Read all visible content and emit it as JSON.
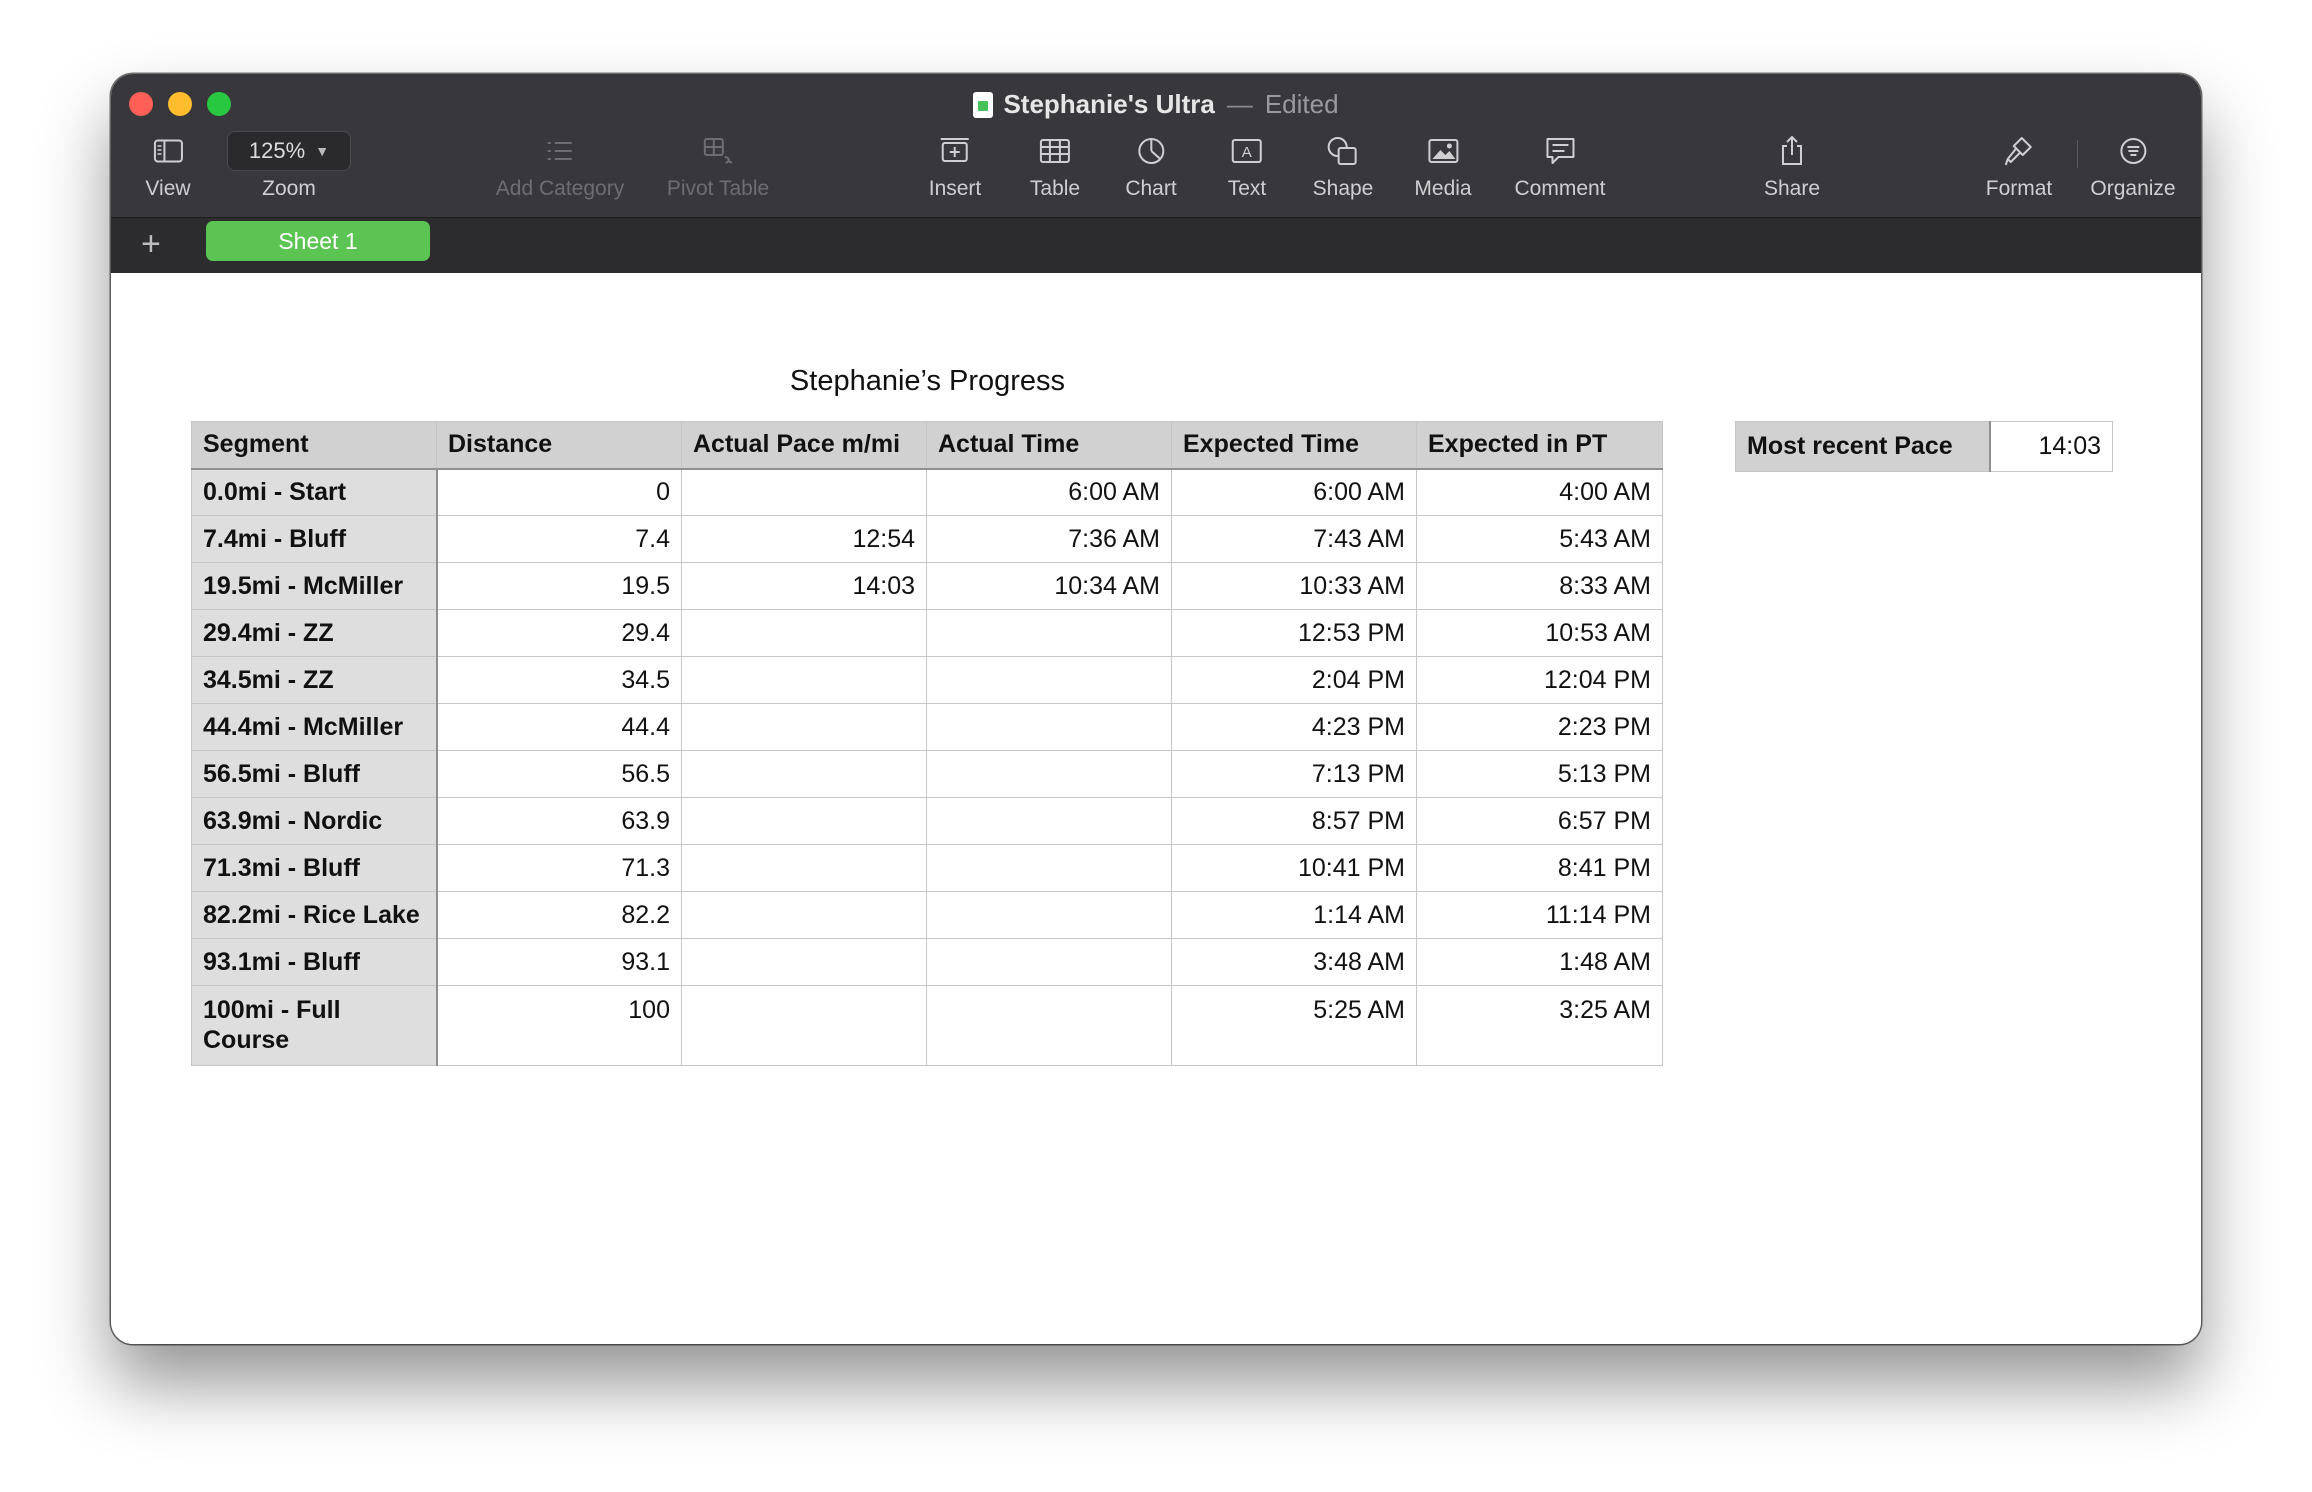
{
  "window": {
    "title": "Stephanie's Ultra",
    "separator": "—",
    "status": "Edited"
  },
  "toolbar": {
    "view": {
      "label": "View",
      "icon": "sidebar-icon"
    },
    "zoom": {
      "label": "Zoom",
      "value": "125%"
    },
    "add_category": {
      "label": "Add Category",
      "icon": "list-icon",
      "enabled": false
    },
    "pivot_table": {
      "label": "Pivot Table",
      "icon": "pivot-table-icon",
      "enabled": false
    },
    "insert": {
      "label": "Insert",
      "icon": "insert-icon"
    },
    "table": {
      "label": "Table",
      "icon": "table-icon"
    },
    "chart": {
      "label": "Chart",
      "icon": "chart-icon"
    },
    "text": {
      "label": "Text",
      "icon": "text-box-icon"
    },
    "shape": {
      "label": "Shape",
      "icon": "shape-icon"
    },
    "media": {
      "label": "Media",
      "icon": "media-icon"
    },
    "comment": {
      "label": "Comment",
      "icon": "comment-icon"
    },
    "share": {
      "label": "Share",
      "icon": "share-icon"
    },
    "format": {
      "label": "Format",
      "icon": "paintbrush-icon"
    },
    "organize": {
      "label": "Organize",
      "icon": "organize-icon"
    }
  },
  "sheets": {
    "add_label": "+",
    "tabs": [
      {
        "label": "Sheet 1",
        "active": true
      }
    ],
    "active_color": "#5cc452"
  },
  "progress_table": {
    "title": "Stephanie’s Progress",
    "columns": [
      "Segment",
      "Distance",
      "Actual Pace m/mi",
      "Actual Time",
      "Expected Time",
      "Expected in PT"
    ],
    "rows": [
      [
        "0.0mi - Start",
        "0",
        "",
        "6:00 AM",
        "6:00 AM",
        "4:00 AM"
      ],
      [
        "7.4mi - Bluff",
        "7.4",
        "12:54",
        "7:36 AM",
        "7:43 AM",
        "5:43 AM"
      ],
      [
        "19.5mi - McMiller",
        "19.5",
        "14:03",
        "10:34 AM",
        "10:33 AM",
        "8:33 AM"
      ],
      [
        "29.4mi - ZZ",
        "29.4",
        "",
        "",
        "12:53 PM",
        "10:53 AM"
      ],
      [
        "34.5mi - ZZ",
        "34.5",
        "",
        "",
        "2:04 PM",
        "12:04 PM"
      ],
      [
        "44.4mi - McMiller",
        "44.4",
        "",
        "",
        "4:23 PM",
        "2:23 PM"
      ],
      [
        "56.5mi - Bluff",
        "56.5",
        "",
        "",
        "7:13 PM",
        "5:13 PM"
      ],
      [
        "63.9mi - Nordic",
        "63.9",
        "",
        "",
        "8:57 PM",
        "6:57 PM"
      ],
      [
        "71.3mi - Bluff",
        "71.3",
        "",
        "",
        "10:41 PM",
        "8:41 PM"
      ],
      [
        "82.2mi - Rice Lake",
        "82.2",
        "",
        "",
        "1:14 AM",
        "11:14 PM"
      ],
      [
        "93.1mi - Bluff",
        "93.1",
        "",
        "",
        "3:48 AM",
        "1:48 AM"
      ],
      [
        "100mi - Full Course",
        "100",
        "",
        "",
        "5:25 AM",
        "3:25 AM"
      ]
    ]
  },
  "pace_table": {
    "label": "Most recent Pace",
    "value": "14:03"
  }
}
